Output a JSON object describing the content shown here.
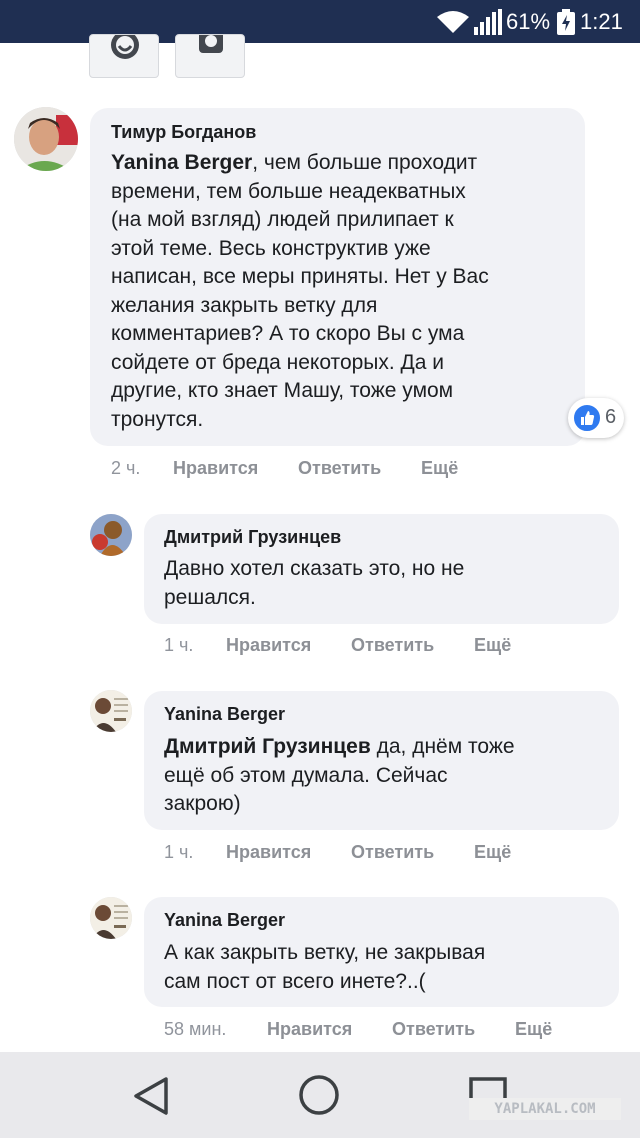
{
  "status_bar": {
    "battery_percent": "61%",
    "time": "1:21",
    "background": "#1f2f52"
  },
  "comments": [
    {
      "author": "Тимур Богданов",
      "mention": "Yanina Berger",
      "lines": [
        ", чем больше проходит",
        "времени, тем больше неадекватных",
        "(на мой взгляд) людей прилипает к",
        "этой теме. Весь конструктив уже",
        "написан, все меры приняты. Нет у Вас",
        "желания закрыть ветку для",
        "комментариев? А то скоро Вы с ума",
        "сойдете от бреда некоторых. Да и",
        "другие, кто знает Машу, тоже умом",
        "тронутся."
      ],
      "time": "2 ч.",
      "like_label": "Нравится",
      "reply_label": "Ответить",
      "more_label": "Ещё",
      "reaction_icon": "like-icon",
      "reaction_count": "6"
    },
    {
      "author": "Дмитрий Грузинцев",
      "lines": [
        "Давно хотел сказать это, но не",
        "решался."
      ],
      "time": "1 ч.",
      "like_label": "Нравится",
      "reply_label": "Ответить",
      "more_label": "Ещё"
    },
    {
      "author": "Yanina Berger",
      "mention": "Дмитрий Грузинцев",
      "lines": [
        " да, днём тоже",
        "ещё об этом думала. Сейчас",
        "закрою)"
      ],
      "time": "1 ч.",
      "like_label": "Нравится",
      "reply_label": "Ответить",
      "more_label": "Ещё"
    },
    {
      "author": "Yanina Berger",
      "lines": [
        "А как закрыть ветку, не закрывая",
        "сам пост от всего инете?..("
      ],
      "time": "58 мин.",
      "like_label": "Нравится",
      "reply_label": "Ответить",
      "more_label": "Ещё"
    }
  ],
  "navbar": {
    "back_icon": "back-triangle-icon",
    "home_icon": "home-circle-icon",
    "recent_icon": "recent-apps-square-icon",
    "watermark": "YAPLAKAL.COM"
  },
  "colors": {
    "bubble": "#f1f2f6",
    "meta_text": "#90949c",
    "like_blue": "#2f7af0"
  }
}
